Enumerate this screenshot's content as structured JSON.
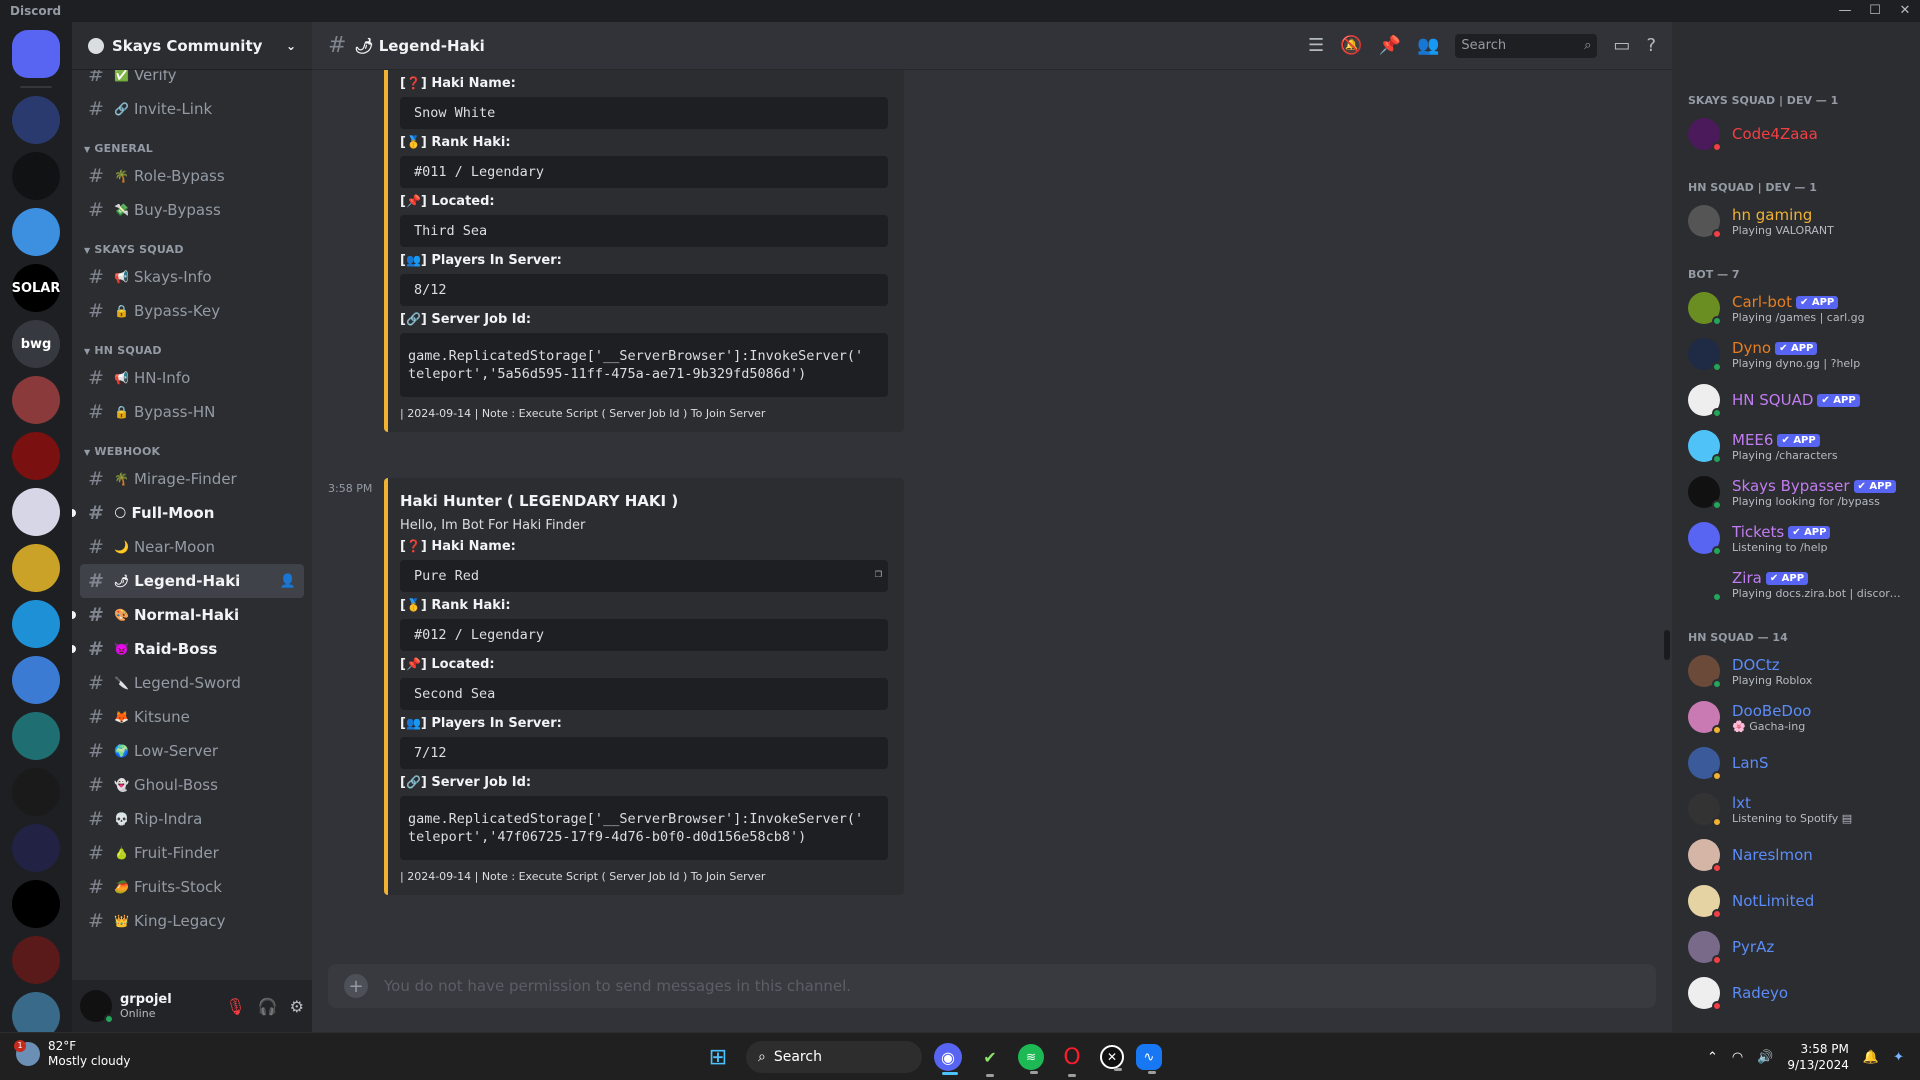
{
  "window": {
    "app_title": "Discord",
    "minimize": "—",
    "maximize": "☐",
    "close": "✕"
  },
  "servers": [
    {
      "name": "discord-home",
      "label": "",
      "color": "#5865f2"
    },
    {
      "name": "skays",
      "label": "",
      "color": "#2a3a6e"
    },
    {
      "name": "ps",
      "label": "",
      "color": "#111214"
    },
    {
      "name": "blue",
      "label": "",
      "color": "#3d8fe0"
    },
    {
      "name": "solar",
      "label": "SOLAR",
      "color": "#000000"
    },
    {
      "name": "bwg",
      "label": "bwg",
      "color": "#36393f"
    },
    {
      "name": "anime1",
      "label": "",
      "color": "#8a3a3a"
    },
    {
      "name": "eternal",
      "label": "",
      "color": "#7a1010"
    },
    {
      "name": "kuromi",
      "label": "",
      "color": "#d6d6e6"
    },
    {
      "name": "cat",
      "label": "",
      "color": "#c9a227"
    },
    {
      "name": "drop",
      "label": "",
      "color": "#1e90d6"
    },
    {
      "name": "anime2",
      "label": "",
      "color": "#3c7bd3"
    },
    {
      "name": "teal",
      "label": "",
      "color": "#1f6e72"
    },
    {
      "name": "moon",
      "label": "",
      "color": "#1a1a1a"
    },
    {
      "name": "solara",
      "label": "",
      "color": "#222244"
    },
    {
      "name": "swirl",
      "label": "",
      "color": "#000000"
    },
    {
      "name": "red-swirl",
      "label": "",
      "color": "#5a1a1a"
    },
    {
      "name": "anime3",
      "label": "",
      "color": "#3a6a8a"
    }
  ],
  "sidebar": {
    "server_name": "Skays Community",
    "top_channels": [
      {
        "name": "Verify",
        "emoji": "✅"
      },
      {
        "name": "Invite-Link",
        "emoji": "🔗"
      }
    ],
    "categories": [
      {
        "label": "GENERAL",
        "channels": [
          {
            "name": "Role-Bypass",
            "emoji": "🌴",
            "state": "normal"
          },
          {
            "name": "Buy-Bypass",
            "emoji": "💸",
            "state": "normal"
          }
        ]
      },
      {
        "label": "SKAYS SQUAD",
        "channels": [
          {
            "name": "Skays-Info",
            "emoji": "📢",
            "state": "normal"
          },
          {
            "name": "Bypass-Key",
            "emoji": "🔒",
            "state": "normal"
          }
        ]
      },
      {
        "label": "HN SQUAD",
        "channels": [
          {
            "name": "HN-Info",
            "emoji": "📢",
            "state": "normal"
          },
          {
            "name": "Bypass-HN",
            "emoji": "🔒",
            "state": "normal"
          }
        ]
      },
      {
        "label": "WEBHOOK",
        "channels": [
          {
            "name": "Mirage-Finder",
            "emoji": "🌴",
            "state": "normal"
          },
          {
            "name": "Full-Moon",
            "emoji": "🌕",
            "state": "unread"
          },
          {
            "name": "Near-Moon",
            "emoji": "🌙",
            "state": "normal"
          },
          {
            "name": "Legend-Haki",
            "emoji": "🌶",
            "state": "selected"
          },
          {
            "name": "Normal-Haki",
            "emoji": "🎨",
            "state": "unread"
          },
          {
            "name": "Raid-Boss",
            "emoji": "👿",
            "state": "unread"
          },
          {
            "name": "Legend-Sword",
            "emoji": "🔪",
            "state": "normal"
          },
          {
            "name": "Kitsune",
            "emoji": "🦊",
            "state": "normal"
          },
          {
            "name": "Low-Server",
            "emoji": "🌍",
            "state": "normal"
          },
          {
            "name": "Ghoul-Boss",
            "emoji": "👻",
            "state": "normal"
          },
          {
            "name": "Rip-Indra",
            "emoji": "💀",
            "state": "normal"
          },
          {
            "name": "Fruit-Finder",
            "emoji": "🍐",
            "state": "normal"
          },
          {
            "name": "Fruits-Stock",
            "emoji": "🥭",
            "state": "normal"
          },
          {
            "name": "King-Legacy",
            "emoji": "👑",
            "state": "normal"
          }
        ]
      }
    ]
  },
  "user": {
    "name": "grpojel",
    "status": "Online"
  },
  "chat": {
    "channel_title": "🌶 Legend-Haki",
    "search_placeholder": "Search",
    "composer_placeholder": "You do not have permission to send messages in this channel.",
    "field_labels": {
      "haki_name": "Haki Name:",
      "rank": "Rank Haki:",
      "located": "Located:",
      "players": "Players In Server:",
      "job_id": "Server Job Id:"
    },
    "field_emojis": {
      "haki_name": "❓",
      "rank": "🥇",
      "located": "📌",
      "players": "👥",
      "job_id": "🔗"
    },
    "embed1": {
      "haki_name": "Snow White",
      "rank": "#011 / Legendary",
      "located": "Third Sea",
      "players": "8/12",
      "job_id": "game.ReplicatedStorage['__ServerBrowser']:InvokeServer('\nteleport','5a56d595-11ff-475a-ae71-9b329fd5086d')",
      "footer": "| 2024-09-14 | Note : Execute Script ( Server Job Id ) To Join Server"
    },
    "embed2": {
      "time": "3:58 PM",
      "title": "Haki Hunter ( LEGENDARY HAKI )",
      "desc": "Hello, Im Bot For Haki Finder",
      "haki_name": "Pure Red",
      "rank": "#012 / Legendary",
      "located": "Second Sea",
      "players": "7/12",
      "job_id": "game.ReplicatedStorage['__ServerBrowser']:InvokeServer('\nteleport','47f06725-17f9-4d76-b0f0-d0d156e58cb8')",
      "footer": "| 2024-09-14 | Note : Execute Script ( Server Job Id ) To Join Server"
    }
  },
  "members": {
    "app_badge": "✔ APP",
    "groups": [
      {
        "label": "SKAYS SQUAD | DEV — 1",
        "members": [
          {
            "name": "Code4Zaaa",
            "color": "#f23f43",
            "activity": "",
            "status": "dnd",
            "av": "#4a1a5a",
            "badge": false
          }
        ]
      },
      {
        "label": "HN SQUAD | DEV — 1",
        "members": [
          {
            "name": "hn gaming",
            "color": "#f0b232",
            "activity": "Playing VALORANT",
            "status": "dnd",
            "av": "#555",
            "badge": false
          }
        ]
      },
      {
        "label": "BOT — 7",
        "members": [
          {
            "name": "Carl-bot",
            "color": "#e67e22",
            "activity": "Playing /games | carl.gg",
            "status": "online",
            "av": "#6b8e23",
            "badge": true
          },
          {
            "name": "Dyno",
            "color": "#e67e22",
            "activity": "Playing dyno.gg | ?help",
            "status": "online",
            "av": "#1f2a44",
            "badge": true
          },
          {
            "name": "HN SQUAD",
            "color": "#c27cf2",
            "activity": "",
            "status": "online",
            "av": "#eeeeee",
            "badge": true
          },
          {
            "name": "MEE6",
            "color": "#c27cf2",
            "activity": "Playing /characters",
            "status": "online",
            "av": "#4fc3f7",
            "badge": true
          },
          {
            "name": "Skays Bypasser",
            "color": "#c27cf2",
            "activity": "Playing looking for /bypass",
            "status": "online",
            "av": "#111",
            "badge": true
          },
          {
            "name": "Tickets",
            "color": "#c27cf2",
            "activity": "Listening to /help",
            "status": "online",
            "av": "#5865f2",
            "badge": true
          },
          {
            "name": "Zira",
            "color": "#c27cf2",
            "activity": "Playing docs.zira.bot | discord...",
            "status": "online",
            "av": "#2b2d31",
            "badge": true
          }
        ]
      },
      {
        "label": "HN SQUAD — 14",
        "members": [
          {
            "name": "DOCtz",
            "color": "#5b8cf7",
            "activity": "Playing Roblox",
            "status": "online",
            "av": "#6b4a3a",
            "badge": false
          },
          {
            "name": "DooBeDoo",
            "color": "#5b8cf7",
            "activity": "🌸 Gacha-ing",
            "status": "idle",
            "av": "#c97ab2",
            "badge": false
          },
          {
            "name": "LanS",
            "color": "#5b8cf7",
            "activity": "",
            "status": "idle",
            "av": "#3a5a9a",
            "badge": false
          },
          {
            "name": "lxt",
            "color": "#5b8cf7",
            "activity": "Listening to Spotify ▤",
            "status": "idle",
            "av": "#333",
            "badge": false
          },
          {
            "name": "Nareslmon",
            "color": "#5b8cf7",
            "activity": "",
            "status": "dnd",
            "av": "#d4b5a6",
            "badge": false
          },
          {
            "name": "NotLimited",
            "color": "#5b8cf7",
            "activity": "",
            "status": "dnd",
            "av": "#e6d3a3",
            "badge": false
          },
          {
            "name": "PyrAz",
            "color": "#5b8cf7",
            "activity": "",
            "status": "dnd",
            "av": "#7a6a8a",
            "badge": false
          },
          {
            "name": "Radeyo",
            "color": "#5b8cf7",
            "activity": "",
            "status": "dnd",
            "av": "#eeeeee",
            "badge": false
          }
        ]
      }
    ]
  },
  "status_colors": {
    "online": "#23a55a",
    "idle": "#f0b232",
    "dnd": "#f23f43"
  },
  "taskbar": {
    "temp": "82°F",
    "condition": "Mostly cloudy",
    "weather_badge": "1",
    "search": "Search",
    "time": "3:58 PM",
    "date": "9/13/2024"
  }
}
